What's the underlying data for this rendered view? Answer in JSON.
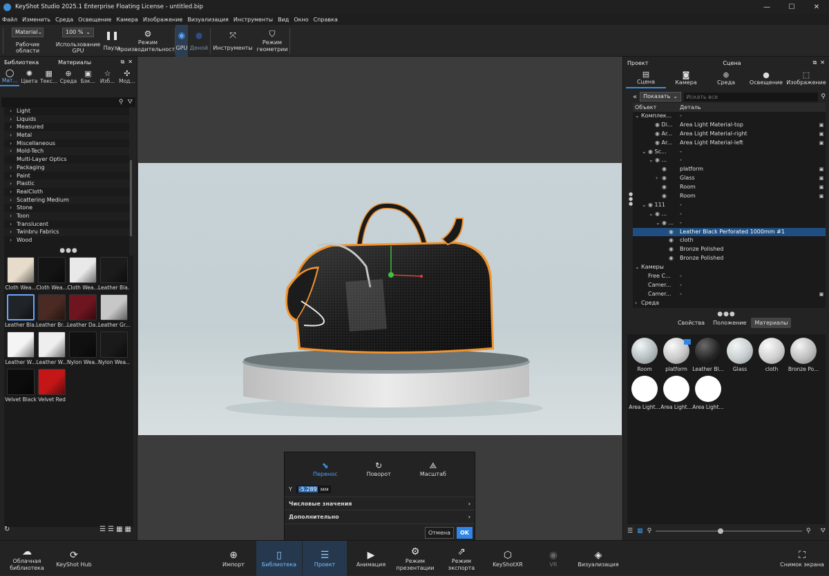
{
  "window": {
    "title": "KeyShot Studio 2025.1 Enterprise Floating License - untitled.bip"
  },
  "menu": [
    "Файл",
    "Изменить",
    "Среда",
    "Освещение",
    "Камера",
    "Изображение",
    "Визуализация",
    "Инструменты",
    "Вид",
    "Окно",
    "Справка"
  ],
  "toolbar": {
    "workspace_value": "Material",
    "workspaces_label": "Рабочие области",
    "gpu_percent": "100 %",
    "gpu_usage_label": "Использование GPU",
    "pause_label": "Пауза",
    "perf_mode_label": "Режим производительности",
    "gpu_label": "GPU",
    "denoise_label": "Деной",
    "tools_label": "Инструменты",
    "geometry_mode_label": "Режим геометрии"
  },
  "library": {
    "header_left": "Библиотека",
    "header_center": "Материалы",
    "tabs": [
      {
        "label": "Мат...",
        "icon": "material-icon",
        "glyph": "◯"
      },
      {
        "label": "Цвета",
        "icon": "palette-icon",
        "glyph": "✺"
      },
      {
        "label": "Текс...",
        "icon": "texture-icon",
        "glyph": "▦"
      },
      {
        "label": "Среда",
        "icon": "globe-icon",
        "glyph": "⊕"
      },
      {
        "label": "Бэк...",
        "icon": "image-icon",
        "glyph": "▣"
      },
      {
        "label": "Изб...",
        "icon": "star-icon",
        "glyph": "☆"
      },
      {
        "label": "Мод...",
        "icon": "models-icon",
        "glyph": "✣"
      }
    ],
    "tree": [
      {
        "label": "Light",
        "chevron": true
      },
      {
        "label": "Liquids",
        "chevron": true
      },
      {
        "label": "Measured",
        "chevron": true
      },
      {
        "label": "Metal",
        "chevron": true
      },
      {
        "label": "Miscellaneous",
        "chevron": true
      },
      {
        "label": "Mold-Tech",
        "chevron": true
      },
      {
        "label": "Multi-Layer Optics",
        "chevron": false
      },
      {
        "label": "Packaging",
        "chevron": true
      },
      {
        "label": "Paint",
        "chevron": true
      },
      {
        "label": "Plastic",
        "chevron": true
      },
      {
        "label": "RealCloth",
        "chevron": true
      },
      {
        "label": "Scattering Medium",
        "chevron": true
      },
      {
        "label": "Stone",
        "chevron": true
      },
      {
        "label": "Toon",
        "chevron": true
      },
      {
        "label": "Translucent",
        "chevron": true
      },
      {
        "label": "Twinbru Fabrics",
        "chevron": true
      },
      {
        "label": "Wood",
        "chevron": true
      }
    ],
    "thumbnails": [
      {
        "label": "Cloth Wea...",
        "color": "#e7dccb"
      },
      {
        "label": "Cloth Wea...",
        "color": "#141414"
      },
      {
        "label": "Cloth Wea...",
        "color": "#e9e9e9"
      },
      {
        "label": "Leather Bla...",
        "color": "#1b1b1b"
      },
      {
        "label": "Leather Bla...",
        "color": "#202428",
        "selected": true
      },
      {
        "label": "Leather Br...",
        "color": "#4a2a22"
      },
      {
        "label": "Leather Da...",
        "color": "#6e1520"
      },
      {
        "label": "Leather Gr...",
        "color": "#c7c7c7"
      },
      {
        "label": "Leather W...",
        "color": "#f4f4f4"
      },
      {
        "label": "Leather W...",
        "color": "#eeeeee"
      },
      {
        "label": "Nylon Wea...",
        "color": "#101010"
      },
      {
        "label": "Nylon Wea...",
        "color": "#1a1a1a"
      },
      {
        "label": "Velvet Black",
        "color": "#0c0c0c"
      },
      {
        "label": "Velvet Red",
        "color": "#c41616"
      }
    ]
  },
  "gizmo": {
    "modes": [
      {
        "label": "Перенос",
        "icon": "move-icon",
        "glyph": "⬊",
        "active": true
      },
      {
        "label": "Поворот",
        "icon": "rotate-icon",
        "glyph": "↻",
        "active": false
      },
      {
        "label": "Масштаб",
        "icon": "scale-icon",
        "glyph": "⟁",
        "active": false
      }
    ],
    "axis_label": "Y",
    "axis_value": "-5.289",
    "unit": "мм",
    "numeric_label": "Числовые значения",
    "advanced_label": "Дополнительно",
    "cancel_label": "Отмена",
    "ok_label": "OK"
  },
  "project": {
    "header_left": "Проект",
    "header_center": "Сцена",
    "tabs": [
      {
        "label": "Сцена",
        "icon": "scene-icon",
        "glyph": "▤",
        "active": true
      },
      {
        "label": "Камера",
        "icon": "camera-icon",
        "glyph": "◙",
        "active": false
      },
      {
        "label": "Среда",
        "icon": "globe-icon",
        "glyph": "⊕",
        "active": false
      },
      {
        "label": "Освещение",
        "icon": "bulb-icon",
        "glyph": "●",
        "active": false
      },
      {
        "label": "Изображение",
        "icon": "image-icon",
        "glyph": "⬚",
        "active": false
      }
    ],
    "filter_value": "Показать",
    "search_placeholder": "Искать все",
    "col_object": "Объект",
    "col_detail": "Деталь",
    "rows": [
      {
        "indent": 0,
        "chev": "⌄",
        "obj": "Комплек...",
        "det": "-",
        "lock": false,
        "eye": false
      },
      {
        "indent": 2,
        "chev": "",
        "obj": "Di...",
        "det": "Area Light Material-top",
        "lock": true,
        "eye": true
      },
      {
        "indent": 2,
        "chev": "",
        "obj": "Ar...",
        "det": "Area Light Material-right",
        "lock": true,
        "eye": true
      },
      {
        "indent": 2,
        "chev": "",
        "obj": "Ar...",
        "det": "Area Light Material-left",
        "lock": true,
        "eye": true
      },
      {
        "indent": 1,
        "chev": "⌄",
        "obj": "Sc...",
        "det": "-",
        "lock": false,
        "eye": true
      },
      {
        "indent": 2,
        "chev": "⌄",
        "obj": "...",
        "det": "-",
        "lock": false,
        "eye": true
      },
      {
        "indent": 3,
        "chev": "",
        "obj": "",
        "det": "platform",
        "lock": true,
        "eye": true
      },
      {
        "indent": 3,
        "chev": "›",
        "obj": "",
        "det": "Glass",
        "lock": true,
        "eye": true
      },
      {
        "indent": 3,
        "chev": "",
        "obj": "",
        "det": "Room",
        "lock": true,
        "eye": true
      },
      {
        "indent": 3,
        "chev": "",
        "obj": "",
        "det": "Room",
        "lock": true,
        "eye": true
      },
      {
        "indent": 1,
        "chev": "⌄",
        "obj": "111",
        "det": "-",
        "lock": false,
        "eye": true
      },
      {
        "indent": 2,
        "chev": "⌄",
        "obj": "...",
        "det": "-",
        "lock": false,
        "eye": true
      },
      {
        "indent": 3,
        "chev": "⌄",
        "obj": "...",
        "det": "-",
        "lock": false,
        "eye": true
      },
      {
        "indent": 4,
        "chev": "",
        "obj": "",
        "det": "Leather Black Perforated 1000mm #1",
        "lock": false,
        "eye": true,
        "selected": true
      },
      {
        "indent": 4,
        "chev": "",
        "obj": "",
        "det": "cloth",
        "lock": false,
        "eye": true
      },
      {
        "indent": 4,
        "chev": "",
        "obj": "",
        "det": "Bronze Polished",
        "lock": false,
        "eye": true
      },
      {
        "indent": 4,
        "chev": "",
        "obj": "",
        "det": "Bronze Polished",
        "lock": false,
        "eye": true
      },
      {
        "indent": 0,
        "chev": "⌄",
        "obj": "Камеры",
        "det": "",
        "lock": false,
        "eye": false
      },
      {
        "indent": 1,
        "chev": "",
        "obj": "Free C...",
        "det": "-",
        "lock": false,
        "eye": false
      },
      {
        "indent": 1,
        "chev": "",
        "obj": "Camer...",
        "det": "-",
        "lock": false,
        "eye": false
      },
      {
        "indent": 1,
        "chev": "",
        "obj": "Camer...",
        "det": "-",
        "lock": true,
        "eye": false
      },
      {
        "indent": 0,
        "chev": "›",
        "obj": "Среда",
        "det": "",
        "lock": false,
        "eye": false
      }
    ],
    "subtabs": [
      {
        "label": "Свойства",
        "active": false
      },
      {
        "label": "Положение",
        "active": false
      },
      {
        "label": "Материалы",
        "active": true
      }
    ],
    "materials": [
      {
        "label": "Room",
        "bg": "radial-gradient(circle at 35% 30%,#f2f6f6,#aeb7b8 60%,#7c8485)"
      },
      {
        "label": "platform",
        "bg": "radial-gradient(circle at 35% 30%,#fafafa,#c6c6c6 55%,#7a7a7a)"
      },
      {
        "label": "Leather Bl...",
        "bg": "radial-gradient(circle at 35% 30%,#6a6a6a,#262626 55%,#050505)"
      },
      {
        "label": "Glass",
        "bg": "radial-gradient(circle at 35% 30%,#f3f6f6,#c7cdce 55%,#8a9192)"
      },
      {
        "label": "cloth",
        "bg": "radial-gradient(circle at 35% 30%,#fbfbfb,#cfcfcf 55%,#8e8e8e)"
      },
      {
        "label": "Bronze Po...",
        "bg": "radial-gradient(circle at 35% 30%,#f5f5f5,#bdbdbd 55%,#7c7c7c)"
      },
      {
        "label": "Area Light...",
        "bg": "#ffffff"
      },
      {
        "label": "Area Light...",
        "bg": "#ffffff"
      },
      {
        "label": "Area Light...",
        "bg": "#ffffff"
      }
    ]
  },
  "bottombar": [
    {
      "label": "Облачная библиотека",
      "icon": "cloud-library-icon",
      "glyph": "☁",
      "active": false,
      "disabled": false
    },
    {
      "label": "KeyShot Hub",
      "icon": "hub-icon",
      "glyph": "⟳",
      "active": false,
      "disabled": false
    },
    {
      "label": "Импорт",
      "icon": "import-icon",
      "glyph": "⊕",
      "active": false,
      "disabled": false
    },
    {
      "label": "Библиотека",
      "icon": "library-book-icon",
      "glyph": "▯",
      "active": true,
      "disabled": false
    },
    {
      "label": "Проект",
      "icon": "project-list-icon",
      "glyph": "☰",
      "active": true,
      "disabled": false
    },
    {
      "label": "Анимация",
      "icon": "animation-play-icon",
      "glyph": "▶",
      "active": false,
      "disabled": false
    },
    {
      "label": "Режим презентации",
      "icon": "presentation-icon",
      "glyph": "⚙",
      "active": false,
      "disabled": false
    },
    {
      "label": "Режим экспорта",
      "icon": "export-icon",
      "glyph": "⇗",
      "active": false,
      "disabled": false
    },
    {
      "label": "KeyShotXR",
      "icon": "xr-cube-icon",
      "glyph": "⬡",
      "active": false,
      "disabled": false
    },
    {
      "label": "VR",
      "icon": "vr-headset-icon",
      "glyph": "◉",
      "active": false,
      "disabled": true
    },
    {
      "label": "Визуализация",
      "icon": "render-icon",
      "glyph": "◈",
      "active": false,
      "disabled": false
    },
    {
      "label": "Снимок экрана",
      "icon": "screenshot-icon",
      "glyph": "⛶",
      "active": false,
      "disabled": false
    }
  ],
  "colors": {
    "accent": "#3a8fe0",
    "selection": "#1f4f82",
    "outline": "#f0922e"
  }
}
